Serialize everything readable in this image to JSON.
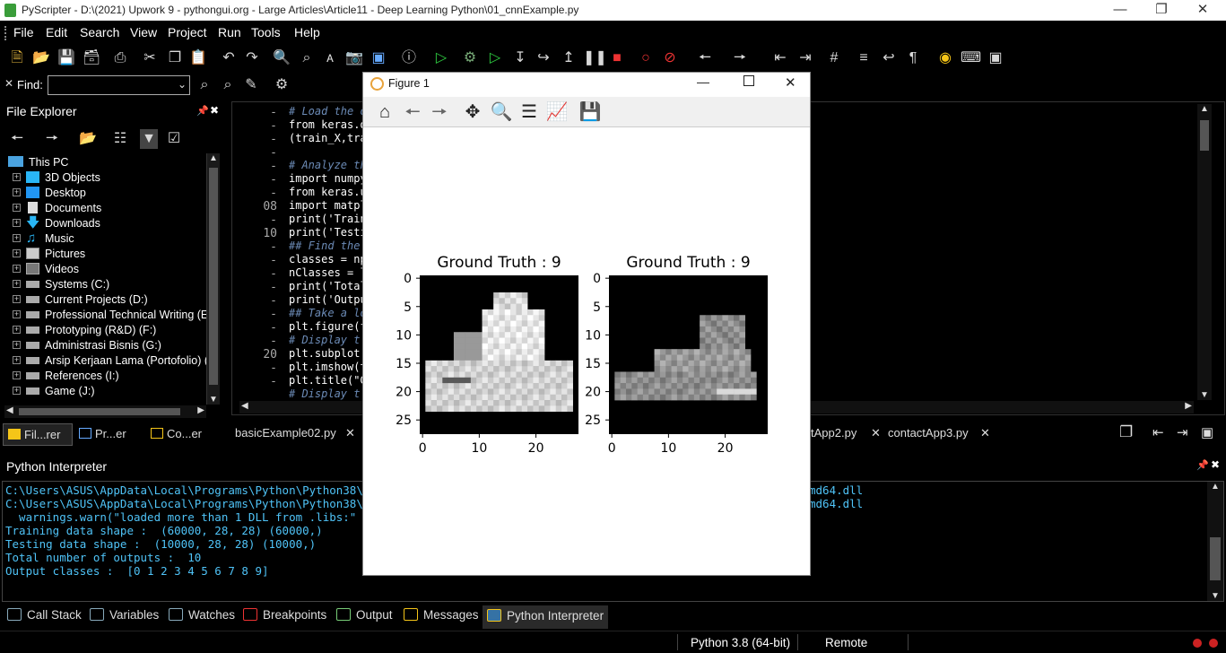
{
  "app": {
    "title": "PyScripter - D:\\(2021) Upwork 9 - pythongui.org - Large Articles\\Article11 - Deep Learning Python\\01_cnnExample.py"
  },
  "menu": [
    "File",
    "Edit",
    "Search",
    "View",
    "Project",
    "Run",
    "Tools",
    "Help"
  ],
  "find": {
    "label": "Find:",
    "value": ""
  },
  "file_explorer": {
    "title": "File Explorer",
    "root": "This PC",
    "items": [
      "3D Objects",
      "Desktop",
      "Documents",
      "Downloads",
      "Music",
      "Pictures",
      "Videos",
      "Systems (C:)",
      "Current Projects (D:)",
      "Professional Technical Writing (E:)",
      "Prototyping (R&D) (F:)",
      "Administrasi Bisnis (G:)",
      "Arsip Kerjaan Lama (Portofolio) (H",
      "References (I:)",
      "Game (J:)"
    ],
    "tabs": [
      "Fil...rer",
      "Pr...er",
      "Co...er"
    ]
  },
  "editor": {
    "gutter": [
      {
        "t": "-"
      },
      {
        "t": "-"
      },
      {
        "t": "-"
      },
      {
        "t": "-"
      },
      {
        "t": "-"
      },
      {
        "t": "-"
      },
      {
        "t": "-"
      },
      {
        "t": "08"
      },
      {
        "t": "-"
      },
      {
        "t": "10"
      },
      {
        "t": "-"
      },
      {
        "t": "-"
      },
      {
        "t": "-"
      },
      {
        "t": "-"
      },
      {
        "t": "-"
      },
      {
        "t": "-"
      },
      {
        "t": "-"
      },
      {
        "t": "-"
      },
      {
        "t": "20"
      },
      {
        "t": "-"
      },
      {
        "t": "-"
      }
    ],
    "lines": [
      {
        "text": "# Load the d",
        "cls": "cm"
      },
      {
        "text": "from keras.d",
        "cls": "kw"
      },
      {
        "text": "(train_X,tra",
        "cls": "kw"
      },
      {
        "text": "",
        "cls": "kw"
      },
      {
        "text": "# Analyze th",
        "cls": "cm"
      },
      {
        "text": "import numpy",
        "cls": "kw"
      },
      {
        "text": "from keras.u",
        "cls": "kw"
      },
      {
        "text": "import matpl",
        "cls": "kw"
      },
      {
        "text": "print('Train",
        "cls": "kw"
      },
      {
        "text": "print('Testi",
        "cls": "kw"
      },
      {
        "text": "## Find the ",
        "cls": "cm"
      },
      {
        "text": "classes = np",
        "cls": "kw"
      },
      {
        "text": "nClasses = l",
        "cls": "kw"
      },
      {
        "text": "print('Total",
        "cls": "kw"
      },
      {
        "text": "print('Outpu",
        "cls": "kw"
      },
      {
        "text": "## Take a lo",
        "cls": "cm"
      },
      {
        "text": "plt.figure(f",
        "cls": "kw"
      },
      {
        "text": "# Display t",
        "cls": "cm"
      },
      {
        "text": "plt.subplot(",
        "cls": "kw"
      },
      {
        "text": "plt.imshow(t",
        "cls": "kw"
      },
      {
        "text": "plt.title(\"G",
        "cls": "kw"
      },
      {
        "text": "# Display t",
        "cls": "cm"
      }
    ],
    "tabs": [
      {
        "label": "basicExample02.py"
      },
      {
        "label": "tApp2.py"
      },
      {
        "label": "contactApp3.py"
      }
    ]
  },
  "interpreter": {
    "title": "Python Interpreter",
    "lines": [
      "C:\\Users\\ASUS\\AppData\\Local\\Programs\\Python\\Python38\\lib\\",
      "C:\\Users\\ASUS\\AppData\\Local\\Programs\\Python\\Python38\\lib\\",
      "  warnings.warn(\"loaded more than 1 DLL from .libs:\"",
      "Training data shape :  (60000, 28, 28) (60000,)",
      "Testing data shape :  (10000, 28, 28) (10000,)",
      "Total number of outputs :  10",
      "Output classes :  [0 1 2 3 4 5 6 7 8 9]"
    ],
    "right_fragments": [
      "md64.dll",
      "md64.dll"
    ]
  },
  "bottom_tabs": [
    "Call Stack",
    "Variables",
    "Watches",
    "Breakpoints",
    "Output",
    "Messages",
    "Python Interpreter"
  ],
  "status": {
    "python": "Python 3.8 (64-bit)",
    "mode": "Remote"
  },
  "figure": {
    "title": "Figure 1",
    "subplots": [
      {
        "title": "Ground Truth : 9",
        "yticks": [
          "0",
          "5",
          "10",
          "15",
          "20",
          "25"
        ],
        "xticks": [
          "0",
          "10",
          "20"
        ]
      },
      {
        "title": "Ground Truth : 9",
        "yticks": [
          "0",
          "5",
          "10",
          "15",
          "20",
          "25"
        ],
        "xticks": [
          "0",
          "10",
          "20"
        ]
      }
    ]
  },
  "colors": {
    "accent": "#4fc3f7",
    "comment": "#6b8ab5",
    "bg": "#000000"
  }
}
